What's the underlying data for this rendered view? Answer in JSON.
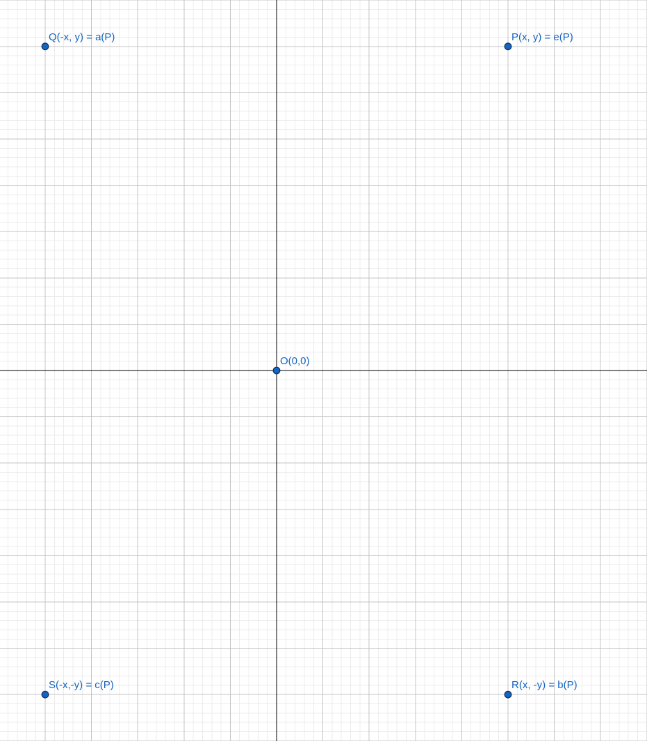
{
  "points": [
    {
      "id": "P",
      "label": "P(x, y) = e(P)",
      "x": 5,
      "y": 7
    },
    {
      "id": "Q",
      "label": "Q(-x, y) = a(P)",
      "x": -5,
      "y": 7
    },
    {
      "id": "O",
      "label": "O(0,0)",
      "x": 0,
      "y": 0
    },
    {
      "id": "S",
      "label": "S(-x,-y) = c(P)",
      "x": -5,
      "y": -7
    },
    {
      "id": "R",
      "label": "R(x, -y) = b(P)",
      "x": 5,
      "y": -7
    }
  ],
  "colors": {
    "point_fill": "#1565c0",
    "point_stroke": "#0d2f5e",
    "label": "#1565c0",
    "axis": "#000000",
    "major_grid": "#c4c4c4",
    "minor_grid": "#ececec"
  }
}
